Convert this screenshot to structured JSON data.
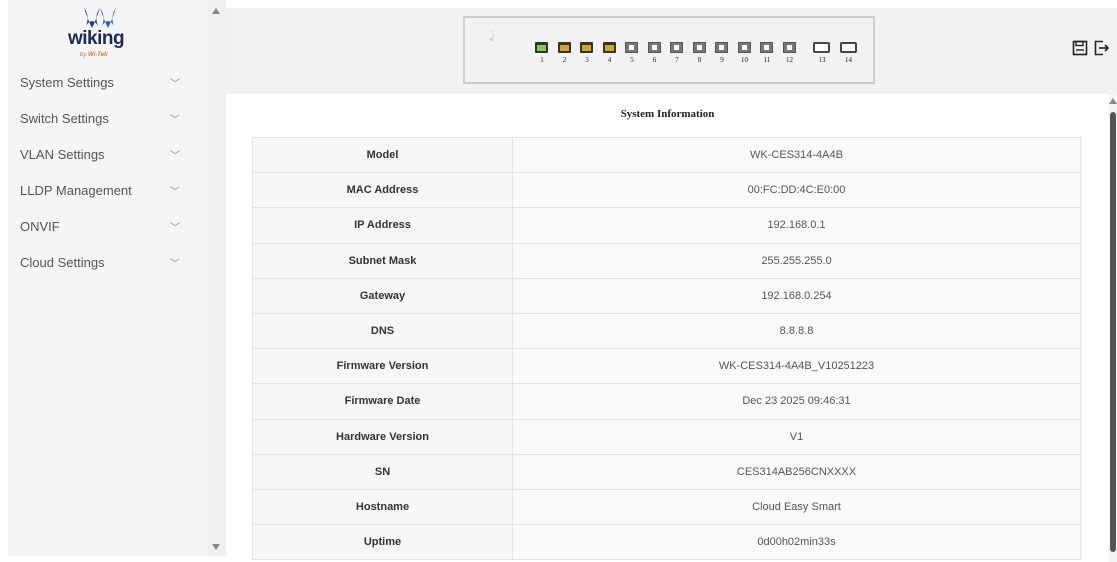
{
  "brand": {
    "name": "wiking",
    "sub_prefix": "by ",
    "sub_brand": "Wi-Tek"
  },
  "sidebar": {
    "items": [
      {
        "label": "System Settings"
      },
      {
        "label": "Switch Settings"
      },
      {
        "label": "VLAN Settings"
      },
      {
        "label": "LLDP Management"
      },
      {
        "label": "ONVIF"
      },
      {
        "label": "Cloud Settings"
      }
    ]
  },
  "panel": {
    "ports": [
      {
        "num": "1",
        "type": "copper",
        "color": "#7bd14a"
      },
      {
        "num": "2",
        "type": "copper",
        "color": "#d9a520"
      },
      {
        "num": "3",
        "type": "copper",
        "color": "#d9a520"
      },
      {
        "num": "4",
        "type": "copper",
        "color": "#d9a520"
      },
      {
        "num": "5",
        "type": "fiber"
      },
      {
        "num": "6",
        "type": "fiber"
      },
      {
        "num": "7",
        "type": "fiber"
      },
      {
        "num": "8",
        "type": "fiber"
      },
      {
        "num": "9",
        "type": "fiber"
      },
      {
        "num": "10",
        "type": "fiber"
      },
      {
        "num": "11",
        "type": "fiber"
      },
      {
        "num": "12",
        "type": "fiber"
      },
      {
        "num": "13",
        "type": "sfp"
      },
      {
        "num": "14",
        "type": "sfp"
      }
    ]
  },
  "main": {
    "title": "System Information",
    "rows": [
      {
        "key": "Model",
        "value": "WK-CES314-4A4B"
      },
      {
        "key": "MAC Address",
        "value": "00:FC:DD:4C:E0:00"
      },
      {
        "key": "IP Address",
        "value": "192.168.0.1"
      },
      {
        "key": "Subnet Mask",
        "value": "255.255.255.0"
      },
      {
        "key": "Gateway",
        "value": "192.168.0.254"
      },
      {
        "key": "DNS",
        "value": "8.8.8.8"
      },
      {
        "key": "Firmware Version",
        "value": "WK-CES314-4A4B_V10251223"
      },
      {
        "key": "Firmware Date",
        "value": "Dec 23 2025 09:46:31"
      },
      {
        "key": "Hardware Version",
        "value": "V1"
      },
      {
        "key": "SN",
        "value": "CES314AB256CNXXXX"
      },
      {
        "key": "Hostname",
        "value": "Cloud Easy Smart"
      },
      {
        "key": "Uptime",
        "value": "0d00h02min33s"
      }
    ]
  },
  "icons": {
    "save": "save-icon",
    "logout": "logout-icon",
    "chevron": "chevron-down-icon"
  }
}
